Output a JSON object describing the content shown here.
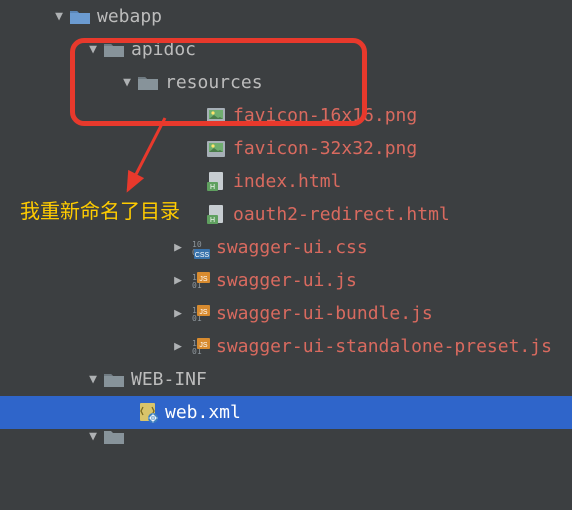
{
  "annotation": {
    "text": "我重新命名了目录"
  },
  "tree": {
    "webapp": {
      "label": "webapp"
    },
    "apidoc": {
      "label": "apidoc"
    },
    "resources": {
      "label": "resources"
    },
    "files": [
      {
        "label": "favicon-16x16.png",
        "kind": "img",
        "arrow": ""
      },
      {
        "label": "favicon-32x32.png",
        "kind": "img",
        "arrow": ""
      },
      {
        "label": "index.html",
        "kind": "html",
        "arrow": ""
      },
      {
        "label": "oauth2-redirect.html",
        "kind": "html",
        "arrow": ""
      },
      {
        "label": "swagger-ui.css",
        "kind": "css",
        "arrow": "▶"
      },
      {
        "label": "swagger-ui.js",
        "kind": "js",
        "arrow": "▶"
      },
      {
        "label": "swagger-ui-bundle.js",
        "kind": "js",
        "arrow": "▶"
      },
      {
        "label": "swagger-ui-standalone-preset.js",
        "kind": "js",
        "arrow": "▶"
      }
    ],
    "webinf": {
      "label": "WEB-INF"
    },
    "webxml": {
      "label": "web.xml"
    }
  }
}
